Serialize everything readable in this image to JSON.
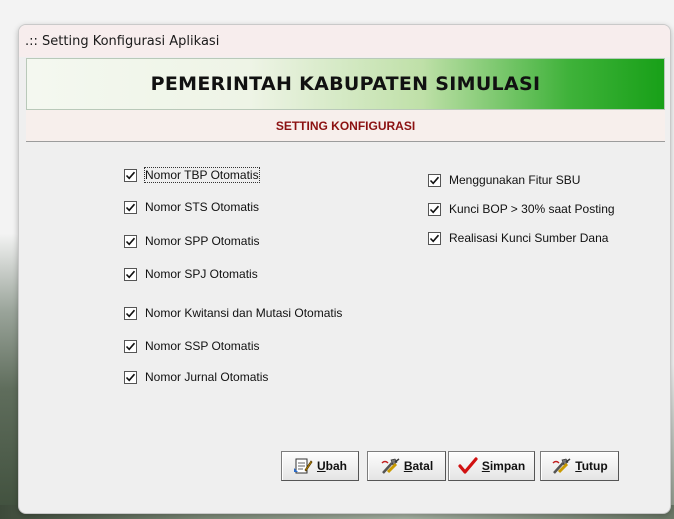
{
  "window": {
    "title": ".:: Setting Konfigurasi Aplikasi"
  },
  "banner": {
    "title": "PEMERINTAH KABUPATEN SIMULASI"
  },
  "section": {
    "title": "SETTING KONFIGURASI"
  },
  "left_options": [
    {
      "label": "Nomor TBP Otomatis",
      "checked": true
    },
    {
      "label": "Nomor STS Otomatis",
      "checked": true
    },
    {
      "label": "Nomor SPP Otomatis",
      "checked": true
    },
    {
      "label": "Nomor SPJ Otomatis",
      "checked": true
    },
    {
      "label": "Nomor Kwitansi dan Mutasi Otomatis",
      "checked": true
    },
    {
      "label": "Nomor SSP Otomatis",
      "checked": true
    },
    {
      "label": "Nomor Jurnal Otomatis",
      "checked": true
    }
  ],
  "right_options": [
    {
      "label": "Menggunakan Fitur SBU",
      "checked": true
    },
    {
      "label": "Kunci BOP > 30% saat Posting",
      "checked": true
    },
    {
      "label": "Realisasi Kunci Sumber Dana",
      "checked": true
    }
  ],
  "buttons": {
    "ubah": {
      "first": "U",
      "rest": "bah",
      "icon": "edit-document-icon"
    },
    "batal": {
      "first": "B",
      "rest": "atal",
      "icon": "tools-icon"
    },
    "simpan": {
      "first": "S",
      "rest": "impan",
      "icon": "checkmark-icon"
    },
    "tutup": {
      "first": "T",
      "rest": "utup",
      "icon": "tools-icon"
    }
  },
  "colors": {
    "banner_green": "#18a018",
    "subtitle_red": "#8b1111",
    "check_red": "#d11111"
  }
}
